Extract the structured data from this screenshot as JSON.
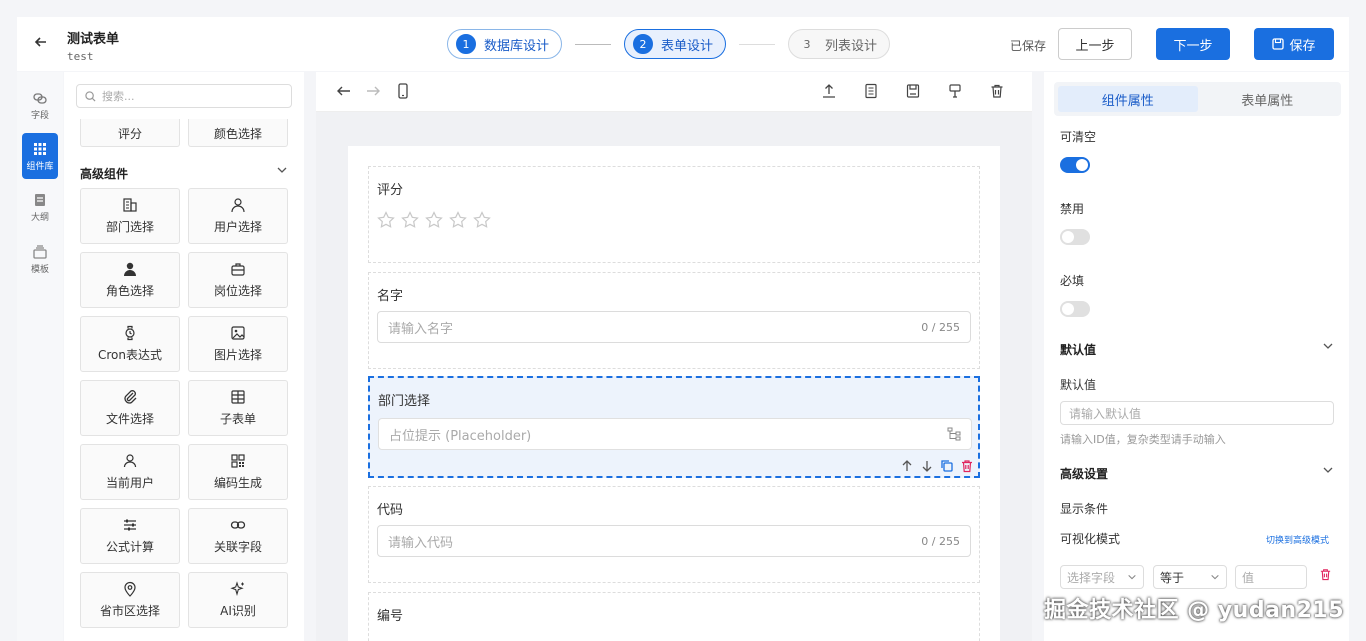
{
  "header": {
    "title": "测试表单",
    "subtitle": "test",
    "steps": [
      {
        "num": "1",
        "label": "数据库设计"
      },
      {
        "num": "2",
        "label": "表单设计"
      },
      {
        "num": "3",
        "label": "列表设计"
      }
    ],
    "saved_text": "已保存",
    "prev_label": "上一步",
    "next_label": "下一步",
    "save_label": "保存"
  },
  "rail": {
    "items": [
      {
        "label": "字段",
        "icon": "link-icon"
      },
      {
        "label": "组件库",
        "icon": "grid-icon"
      },
      {
        "label": "大纲",
        "icon": "outline-icon"
      },
      {
        "label": "模板",
        "icon": "template-icon"
      }
    ]
  },
  "components": {
    "search_placeholder": "搜索...",
    "top_partial": [
      "评分",
      "颜色选择"
    ],
    "section_title": "高级组件",
    "cards": [
      {
        "label": "部门选择",
        "icon": "building-icon"
      },
      {
        "label": "用户选择",
        "icon": "user-icon"
      },
      {
        "label": "角色选择",
        "icon": "role-icon"
      },
      {
        "label": "岗位选择",
        "icon": "briefcase-icon"
      },
      {
        "label": "Cron表达式",
        "icon": "watch-icon"
      },
      {
        "label": "图片选择",
        "icon": "image-icon"
      },
      {
        "label": "文件选择",
        "icon": "paperclip-icon"
      },
      {
        "label": "子表单",
        "icon": "table-icon"
      },
      {
        "label": "当前用户",
        "icon": "person-icon"
      },
      {
        "label": "编码生成",
        "icon": "qrcode-icon"
      },
      {
        "label": "公式计算",
        "icon": "sliders-icon"
      },
      {
        "label": "关联字段",
        "icon": "chain-icon"
      },
      {
        "label": "省市区选择",
        "icon": "location-icon"
      },
      {
        "label": "AI识别",
        "icon": "sparkle-icon"
      }
    ]
  },
  "canvas": {
    "fields": [
      {
        "label": "评分",
        "type": "rating"
      },
      {
        "label": "名字",
        "placeholder": "请输入名字",
        "count": "0 / 255"
      },
      {
        "label": "部门选择",
        "placeholder": "占位提示 (Placeholder)",
        "selected": true
      },
      {
        "label": "代码",
        "placeholder": "请输入代码",
        "count": "0 / 255"
      },
      {
        "label": "编号"
      }
    ]
  },
  "props": {
    "tabs": [
      "组件属性",
      "表单属性"
    ],
    "clearable_label": "可清空",
    "clearable": true,
    "disabled_label": "禁用",
    "disabled": false,
    "required_label": "必填",
    "required": false,
    "default_section": "默认值",
    "default_label": "默认值",
    "default_placeholder": "请输入默认值",
    "default_hint": "请输入ID值，复杂类型请手动输入",
    "advanced_section": "高级设置",
    "display_condition": "显示条件",
    "visual_mode": "可视化模式",
    "switch_link": "切换到高级模式",
    "cond_field_placeholder": "选择字段",
    "cond_operator": "等于",
    "cond_value_placeholder": "值"
  },
  "watermark": "掘金技术社区 @ yudan215",
  "colors": {
    "accent": "#1a6fe0",
    "danger": "#e0245e"
  }
}
